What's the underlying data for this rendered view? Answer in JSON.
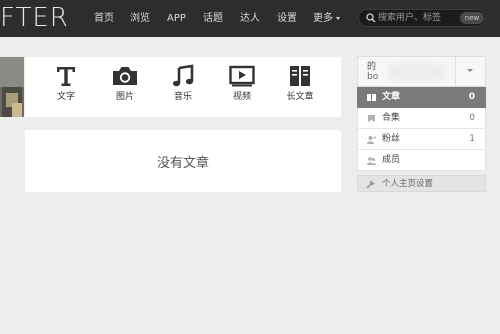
{
  "brand": {
    "logo_text": "FTER"
  },
  "nav": {
    "items": [
      "首页",
      "浏览",
      "APP",
      "话题",
      "达人",
      "设置",
      "更多"
    ]
  },
  "search": {
    "placeholder": "搜索用户、标签",
    "badge": "new"
  },
  "post_types": [
    {
      "label": "文字",
      "icon": "text-icon"
    },
    {
      "label": "图片",
      "icon": "camera-icon"
    },
    {
      "label": "音乐",
      "icon": "music-icon"
    },
    {
      "label": "视频",
      "icon": "video-icon"
    },
    {
      "label": "长文章",
      "icon": "long-article-icon"
    }
  ],
  "main": {
    "empty_message": "没有文章"
  },
  "profile": {
    "name_line": "的",
    "sub_line": "bo"
  },
  "stats": [
    {
      "label": "文章",
      "count": "0",
      "icon": "article-icon",
      "active": true
    },
    {
      "label": "合集",
      "count": "0",
      "icon": "collection-icon",
      "active": false
    },
    {
      "label": "粉丝",
      "count": "1",
      "icon": "followers-icon",
      "active": false
    },
    {
      "label": "成员",
      "count": "",
      "icon": "members-icon",
      "active": false
    }
  ],
  "settings": {
    "label": "个人主页设置",
    "icon": "wrench-icon"
  },
  "colors": {
    "topbar": "#2c2d2e",
    "active_row": "#7a7a7a",
    "background": "#ededed"
  }
}
